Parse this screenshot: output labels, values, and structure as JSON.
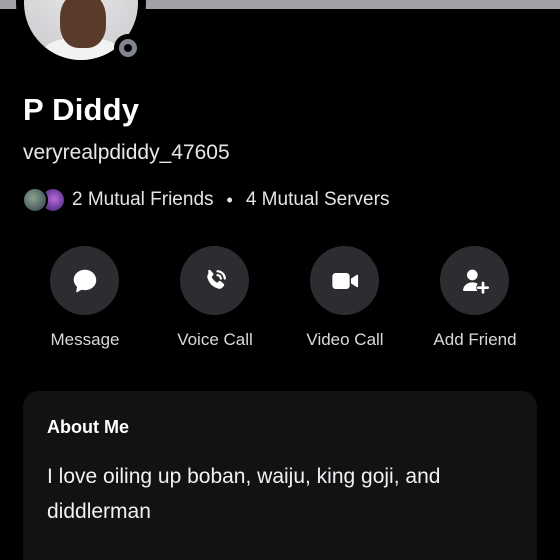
{
  "profile": {
    "display_name": "P Diddy",
    "username": "veryrealpdiddy_47605",
    "status": "offline",
    "banner_color": "#a3a1a6"
  },
  "mutuals": {
    "friends_label": "2 Mutual Friends",
    "separator": "•",
    "servers_label": "4 Mutual Servers"
  },
  "actions": [
    {
      "label": "Message",
      "icon": "chat-bubble-icon"
    },
    {
      "label": "Voice Call",
      "icon": "phone-icon"
    },
    {
      "label": "Video Call",
      "icon": "video-camera-icon"
    },
    {
      "label": "Add Friend",
      "icon": "add-friend-icon"
    }
  ],
  "about": {
    "title": "About Me",
    "body": "I love oiling up boban, waiju, king goji, and diddlerman"
  },
  "colors": {
    "background": "#000000",
    "button_bg": "#2b2d31",
    "card_bg": "#111214",
    "status_offline": "#80848e"
  }
}
